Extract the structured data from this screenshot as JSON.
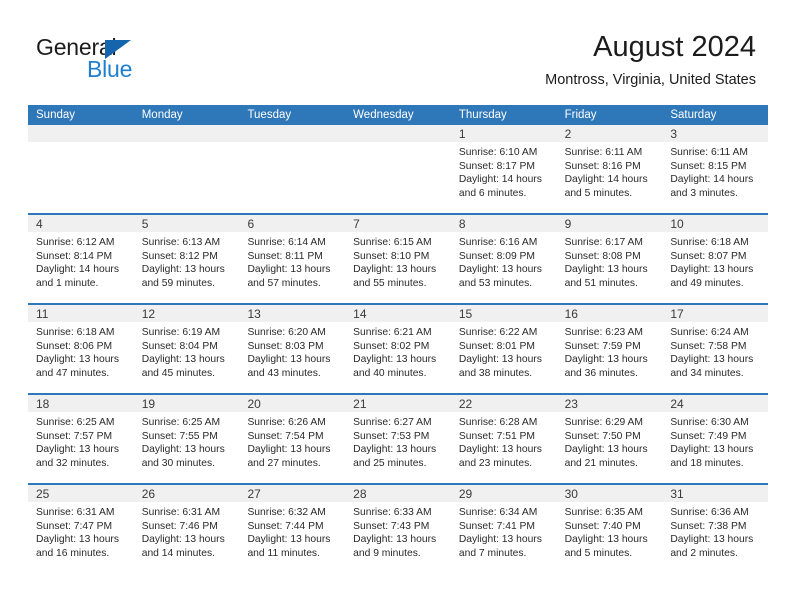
{
  "brand": {
    "name_part1": "General",
    "name_part2": "Blue",
    "accent_color": "#1e7fd0",
    "triangle_color": "#1565ad"
  },
  "header": {
    "title": "August 2024",
    "location": "Montross, Virginia, United States"
  },
  "theme": {
    "header_blue": "#2e77b8",
    "day_band_gray": "#f0f0f0",
    "text_color": "#2a2a2a"
  },
  "weekdays": [
    "Sunday",
    "Monday",
    "Tuesday",
    "Wednesday",
    "Thursday",
    "Friday",
    "Saturday"
  ],
  "weeks": [
    [
      {
        "day": "",
        "sunrise": "",
        "sunset": "",
        "daylight_line1": "",
        "daylight_line2": ""
      },
      {
        "day": "",
        "sunrise": "",
        "sunset": "",
        "daylight_line1": "",
        "daylight_line2": ""
      },
      {
        "day": "",
        "sunrise": "",
        "sunset": "",
        "daylight_line1": "",
        "daylight_line2": ""
      },
      {
        "day": "",
        "sunrise": "",
        "sunset": "",
        "daylight_line1": "",
        "daylight_line2": ""
      },
      {
        "day": "1",
        "sunrise": "Sunrise: 6:10 AM",
        "sunset": "Sunset: 8:17 PM",
        "daylight_line1": "Daylight: 14 hours",
        "daylight_line2": "and 6 minutes."
      },
      {
        "day": "2",
        "sunrise": "Sunrise: 6:11 AM",
        "sunset": "Sunset: 8:16 PM",
        "daylight_line1": "Daylight: 14 hours",
        "daylight_line2": "and 5 minutes."
      },
      {
        "day": "3",
        "sunrise": "Sunrise: 6:11 AM",
        "sunset": "Sunset: 8:15 PM",
        "daylight_line1": "Daylight: 14 hours",
        "daylight_line2": "and 3 minutes."
      }
    ],
    [
      {
        "day": "4",
        "sunrise": "Sunrise: 6:12 AM",
        "sunset": "Sunset: 8:14 PM",
        "daylight_line1": "Daylight: 14 hours",
        "daylight_line2": "and 1 minute."
      },
      {
        "day": "5",
        "sunrise": "Sunrise: 6:13 AM",
        "sunset": "Sunset: 8:12 PM",
        "daylight_line1": "Daylight: 13 hours",
        "daylight_line2": "and 59 minutes."
      },
      {
        "day": "6",
        "sunrise": "Sunrise: 6:14 AM",
        "sunset": "Sunset: 8:11 PM",
        "daylight_line1": "Daylight: 13 hours",
        "daylight_line2": "and 57 minutes."
      },
      {
        "day": "7",
        "sunrise": "Sunrise: 6:15 AM",
        "sunset": "Sunset: 8:10 PM",
        "daylight_line1": "Daylight: 13 hours",
        "daylight_line2": "and 55 minutes."
      },
      {
        "day": "8",
        "sunrise": "Sunrise: 6:16 AM",
        "sunset": "Sunset: 8:09 PM",
        "daylight_line1": "Daylight: 13 hours",
        "daylight_line2": "and 53 minutes."
      },
      {
        "day": "9",
        "sunrise": "Sunrise: 6:17 AM",
        "sunset": "Sunset: 8:08 PM",
        "daylight_line1": "Daylight: 13 hours",
        "daylight_line2": "and 51 minutes."
      },
      {
        "day": "10",
        "sunrise": "Sunrise: 6:18 AM",
        "sunset": "Sunset: 8:07 PM",
        "daylight_line1": "Daylight: 13 hours",
        "daylight_line2": "and 49 minutes."
      }
    ],
    [
      {
        "day": "11",
        "sunrise": "Sunrise: 6:18 AM",
        "sunset": "Sunset: 8:06 PM",
        "daylight_line1": "Daylight: 13 hours",
        "daylight_line2": "and 47 minutes."
      },
      {
        "day": "12",
        "sunrise": "Sunrise: 6:19 AM",
        "sunset": "Sunset: 8:04 PM",
        "daylight_line1": "Daylight: 13 hours",
        "daylight_line2": "and 45 minutes."
      },
      {
        "day": "13",
        "sunrise": "Sunrise: 6:20 AM",
        "sunset": "Sunset: 8:03 PM",
        "daylight_line1": "Daylight: 13 hours",
        "daylight_line2": "and 43 minutes."
      },
      {
        "day": "14",
        "sunrise": "Sunrise: 6:21 AM",
        "sunset": "Sunset: 8:02 PM",
        "daylight_line1": "Daylight: 13 hours",
        "daylight_line2": "and 40 minutes."
      },
      {
        "day": "15",
        "sunrise": "Sunrise: 6:22 AM",
        "sunset": "Sunset: 8:01 PM",
        "daylight_line1": "Daylight: 13 hours",
        "daylight_line2": "and 38 minutes."
      },
      {
        "day": "16",
        "sunrise": "Sunrise: 6:23 AM",
        "sunset": "Sunset: 7:59 PM",
        "daylight_line1": "Daylight: 13 hours",
        "daylight_line2": "and 36 minutes."
      },
      {
        "day": "17",
        "sunrise": "Sunrise: 6:24 AM",
        "sunset": "Sunset: 7:58 PM",
        "daylight_line1": "Daylight: 13 hours",
        "daylight_line2": "and 34 minutes."
      }
    ],
    [
      {
        "day": "18",
        "sunrise": "Sunrise: 6:25 AM",
        "sunset": "Sunset: 7:57 PM",
        "daylight_line1": "Daylight: 13 hours",
        "daylight_line2": "and 32 minutes."
      },
      {
        "day": "19",
        "sunrise": "Sunrise: 6:25 AM",
        "sunset": "Sunset: 7:55 PM",
        "daylight_line1": "Daylight: 13 hours",
        "daylight_line2": "and 30 minutes."
      },
      {
        "day": "20",
        "sunrise": "Sunrise: 6:26 AM",
        "sunset": "Sunset: 7:54 PM",
        "daylight_line1": "Daylight: 13 hours",
        "daylight_line2": "and 27 minutes."
      },
      {
        "day": "21",
        "sunrise": "Sunrise: 6:27 AM",
        "sunset": "Sunset: 7:53 PM",
        "daylight_line1": "Daylight: 13 hours",
        "daylight_line2": "and 25 minutes."
      },
      {
        "day": "22",
        "sunrise": "Sunrise: 6:28 AM",
        "sunset": "Sunset: 7:51 PM",
        "daylight_line1": "Daylight: 13 hours",
        "daylight_line2": "and 23 minutes."
      },
      {
        "day": "23",
        "sunrise": "Sunrise: 6:29 AM",
        "sunset": "Sunset: 7:50 PM",
        "daylight_line1": "Daylight: 13 hours",
        "daylight_line2": "and 21 minutes."
      },
      {
        "day": "24",
        "sunrise": "Sunrise: 6:30 AM",
        "sunset": "Sunset: 7:49 PM",
        "daylight_line1": "Daylight: 13 hours",
        "daylight_line2": "and 18 minutes."
      }
    ],
    [
      {
        "day": "25",
        "sunrise": "Sunrise: 6:31 AM",
        "sunset": "Sunset: 7:47 PM",
        "daylight_line1": "Daylight: 13 hours",
        "daylight_line2": "and 16 minutes."
      },
      {
        "day": "26",
        "sunrise": "Sunrise: 6:31 AM",
        "sunset": "Sunset: 7:46 PM",
        "daylight_line1": "Daylight: 13 hours",
        "daylight_line2": "and 14 minutes."
      },
      {
        "day": "27",
        "sunrise": "Sunrise: 6:32 AM",
        "sunset": "Sunset: 7:44 PM",
        "daylight_line1": "Daylight: 13 hours",
        "daylight_line2": "and 11 minutes."
      },
      {
        "day": "28",
        "sunrise": "Sunrise: 6:33 AM",
        "sunset": "Sunset: 7:43 PM",
        "daylight_line1": "Daylight: 13 hours",
        "daylight_line2": "and 9 minutes."
      },
      {
        "day": "29",
        "sunrise": "Sunrise: 6:34 AM",
        "sunset": "Sunset: 7:41 PM",
        "daylight_line1": "Daylight: 13 hours",
        "daylight_line2": "and 7 minutes."
      },
      {
        "day": "30",
        "sunrise": "Sunrise: 6:35 AM",
        "sunset": "Sunset: 7:40 PM",
        "daylight_line1": "Daylight: 13 hours",
        "daylight_line2": "and 5 minutes."
      },
      {
        "day": "31",
        "sunrise": "Sunrise: 6:36 AM",
        "sunset": "Sunset: 7:38 PM",
        "daylight_line1": "Daylight: 13 hours",
        "daylight_line2": "and 2 minutes."
      }
    ]
  ]
}
